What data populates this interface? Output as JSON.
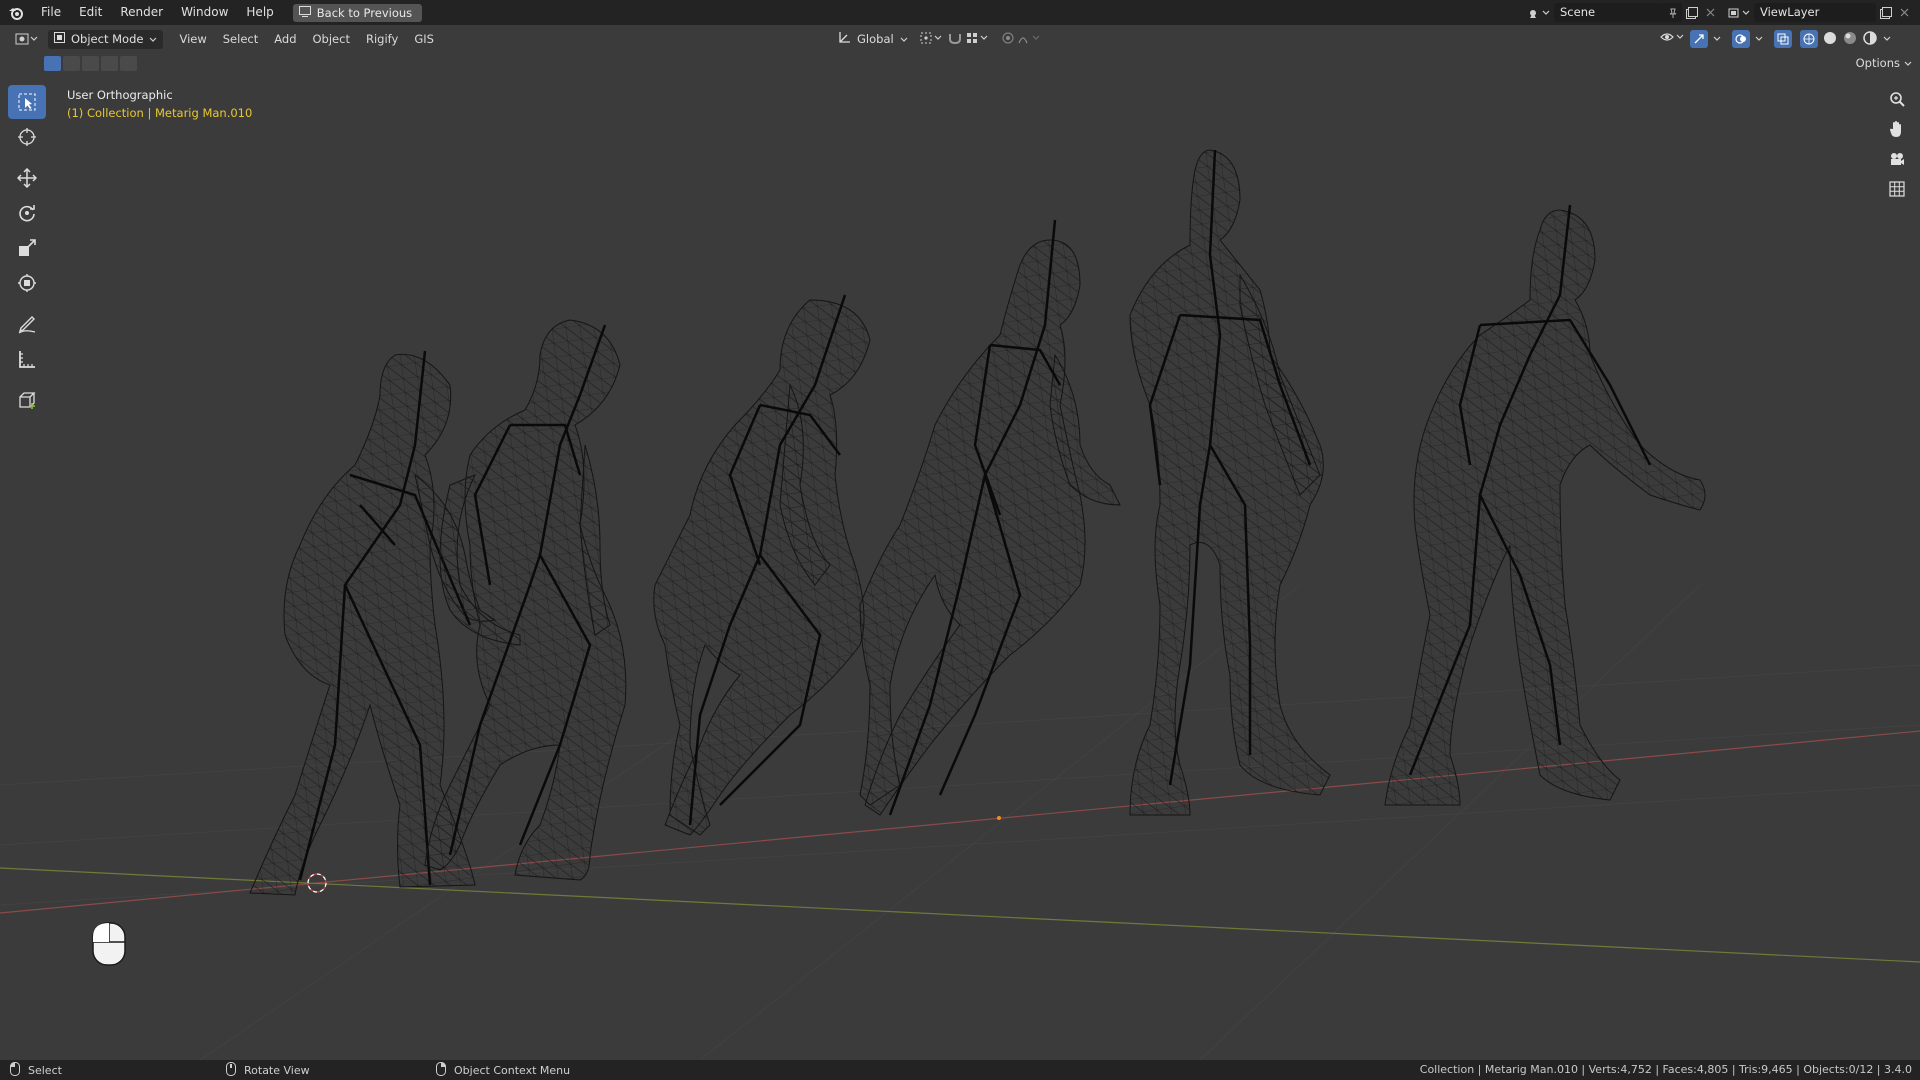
{
  "menubar": {
    "items": [
      "File",
      "Edit",
      "Render",
      "Window",
      "Help"
    ],
    "back_button": "Back to Previous",
    "scene_name": "Scene",
    "view_layer": "ViewLayer"
  },
  "viewport_header": {
    "mode": "Object Mode",
    "menus": [
      "View",
      "Select",
      "Add",
      "Object",
      "Rigify",
      "GIS"
    ],
    "transform_orientation": "Global",
    "options_label": "Options"
  },
  "overlay": {
    "view_name": "User Orthographic",
    "collection_label": "(1) Collection | Metarig Man.010"
  },
  "toolbar": {
    "tools": [
      "select-box-icon",
      "cursor-icon",
      "move-icon",
      "rotate-icon",
      "scale-icon",
      "transform-icon",
      "annotate-icon",
      "measure-icon",
      "add-cube-icon"
    ]
  },
  "navigation": {
    "buttons": [
      "zoom-icon",
      "pan-hand-icon",
      "camera-icon",
      "grid-icon"
    ]
  },
  "statusbar": {
    "hints": [
      "Select",
      "Rotate View",
      "Object Context Menu"
    ],
    "stats": "Collection | Metarig Man.010 | Verts:4,752 | Faces:4,805 | Tris:9,465 | Objects:0/12 | 3.4.0"
  },
  "colors": {
    "accent": "#4772b3",
    "collection_text": "#e8c830",
    "viewport_bg": "#3b3b3b",
    "x_axis": "#8a4a4a",
    "y_axis": "#6f7a3a"
  }
}
